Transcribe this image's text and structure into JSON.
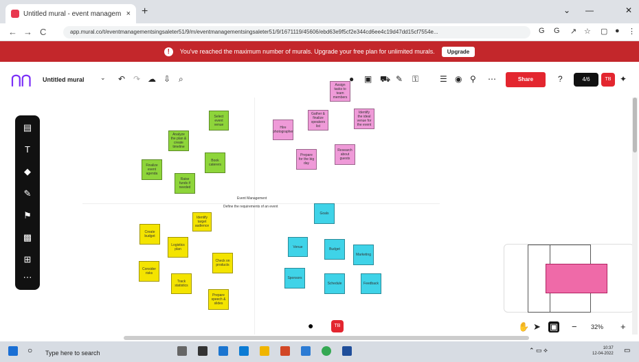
{
  "browser": {
    "tab_title": "Untitled mural - event managem",
    "tab_close": "×",
    "new_tab": "+",
    "url": "app.mural.co/t/eventmanagementsingsaleter51/9/m/eventmanagementsingsaleter51/9/1671119/45606/ebd63e9f5cf2e344cd6ee4c19d47dd15cf7554e...",
    "window_controls": [
      "⌄",
      "—",
      "✕"
    ]
  },
  "banner": {
    "message": "You've reached the maximum number of murals. Upgrade your free plan for unlimited murals.",
    "upgrade_label": "Upgrade"
  },
  "toolbar": {
    "mural_name": "Untitled mural",
    "share_label": "Share",
    "counter": "4/6",
    "user_initials": "TB"
  },
  "canvas": {
    "center_title": "Event Management",
    "center_subtitle": "Define the requirements of an event"
  },
  "notes": {
    "green": [
      "Select event venue",
      "Analyze the plan & create timeline",
      "Book caterers",
      "Finalize event agenda",
      "Raise funds if needed",
      "Send invites"
    ],
    "pink": [
      "Assign tasks to team members",
      "Gather & finalize speakers list",
      "Identify the ideal venue for the event",
      "Hire photographer",
      "Research about guests",
      "Prepare for the big day"
    ],
    "yellow": [
      "Identify target audience",
      "Create budget",
      "Logistics plan",
      "Check on products",
      "Consider risks",
      "Track statistics",
      "Prepare speech & slides",
      "Decor & theme"
    ],
    "cyan": [
      "Goals",
      "Venue",
      "Budget",
      "Marketing",
      "Sponsors",
      "Schedule",
      "Feedback"
    ]
  },
  "zoom": {
    "level": "32%",
    "minus": "−",
    "plus": "+"
  },
  "bottom": {
    "user_initials": "TB"
  },
  "taskbar": {
    "search_placeholder": "Type here to search",
    "time": "10:37",
    "date": "12-04-2022"
  },
  "colors": {
    "banner": "#c3272b",
    "share": "#e3262f",
    "note_green": "#8ed53a",
    "note_pink": "#ef9ad8",
    "note_yellow": "#f4e400",
    "note_cyan": "#3fd3e8"
  }
}
